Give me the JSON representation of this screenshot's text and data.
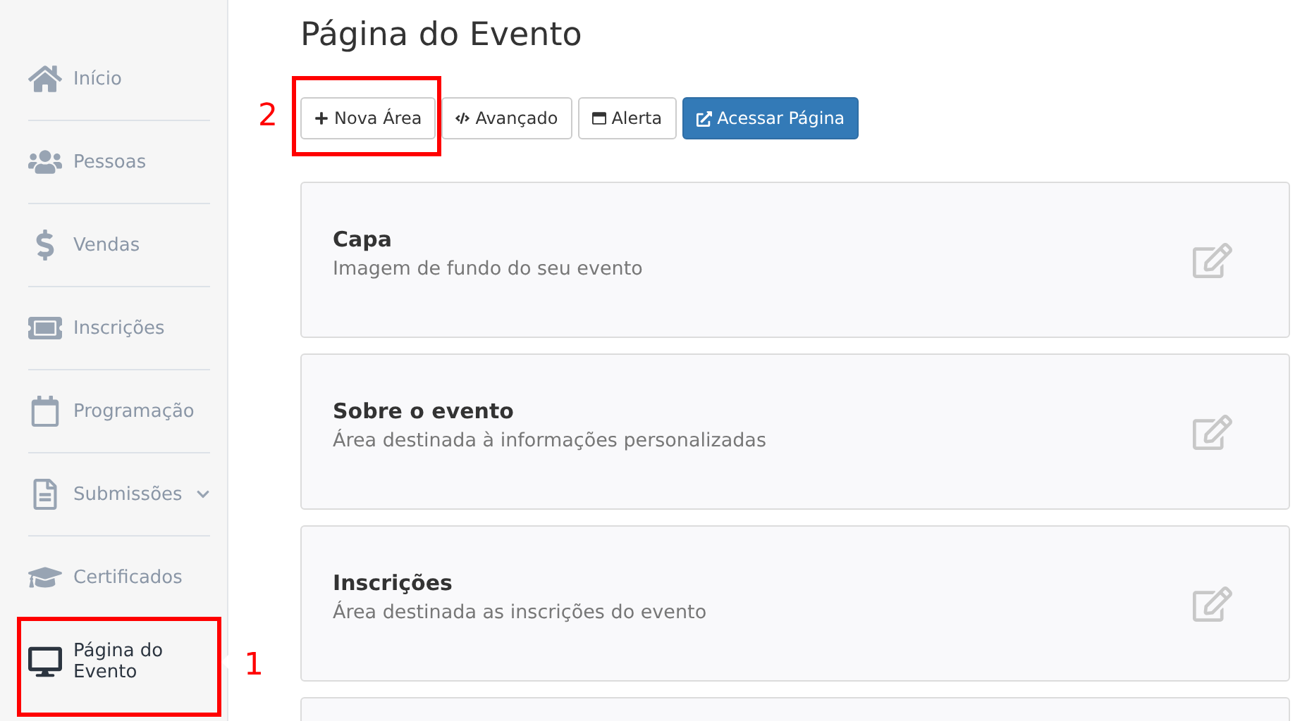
{
  "sidebar": {
    "items": [
      {
        "label": "Início",
        "selected": false,
        "expandable": false,
        "highlighted": false
      },
      {
        "label": "Pessoas",
        "selected": false,
        "expandable": false,
        "highlighted": false
      },
      {
        "label": "Vendas",
        "selected": false,
        "expandable": false,
        "highlighted": false
      },
      {
        "label": "Inscrições",
        "selected": false,
        "expandable": false,
        "highlighted": false
      },
      {
        "label": "Programação",
        "selected": false,
        "expandable": false,
        "highlighted": false
      },
      {
        "label": "Submissões",
        "selected": false,
        "expandable": true,
        "highlighted": false
      },
      {
        "label": "Certificados",
        "selected": false,
        "expandable": false,
        "highlighted": false
      },
      {
        "label": "Página do Evento",
        "selected": true,
        "expandable": false,
        "highlighted": true,
        "callout": "1"
      }
    ]
  },
  "page": {
    "title": "Página do Evento"
  },
  "toolbar": [
    {
      "label": "Nova Área",
      "kind": "default",
      "highlighted": true,
      "callout": "2"
    },
    {
      "label": "Avançado",
      "kind": "default",
      "highlighted": false
    },
    {
      "label": "Alerta",
      "kind": "default",
      "highlighted": false
    },
    {
      "label": "Acessar Página",
      "kind": "primary",
      "highlighted": false
    }
  ],
  "sections": [
    {
      "kind": "section",
      "title": "Capa",
      "description": "Imagem de fundo do seu evento"
    },
    {
      "kind": "section",
      "title": "Sobre o evento",
      "description": "Área destinada à informações personalizadas"
    },
    {
      "kind": "section",
      "title": "Inscrições",
      "description": "Área destinada as inscrições do evento"
    },
    {
      "kind": "partial"
    }
  ]
}
